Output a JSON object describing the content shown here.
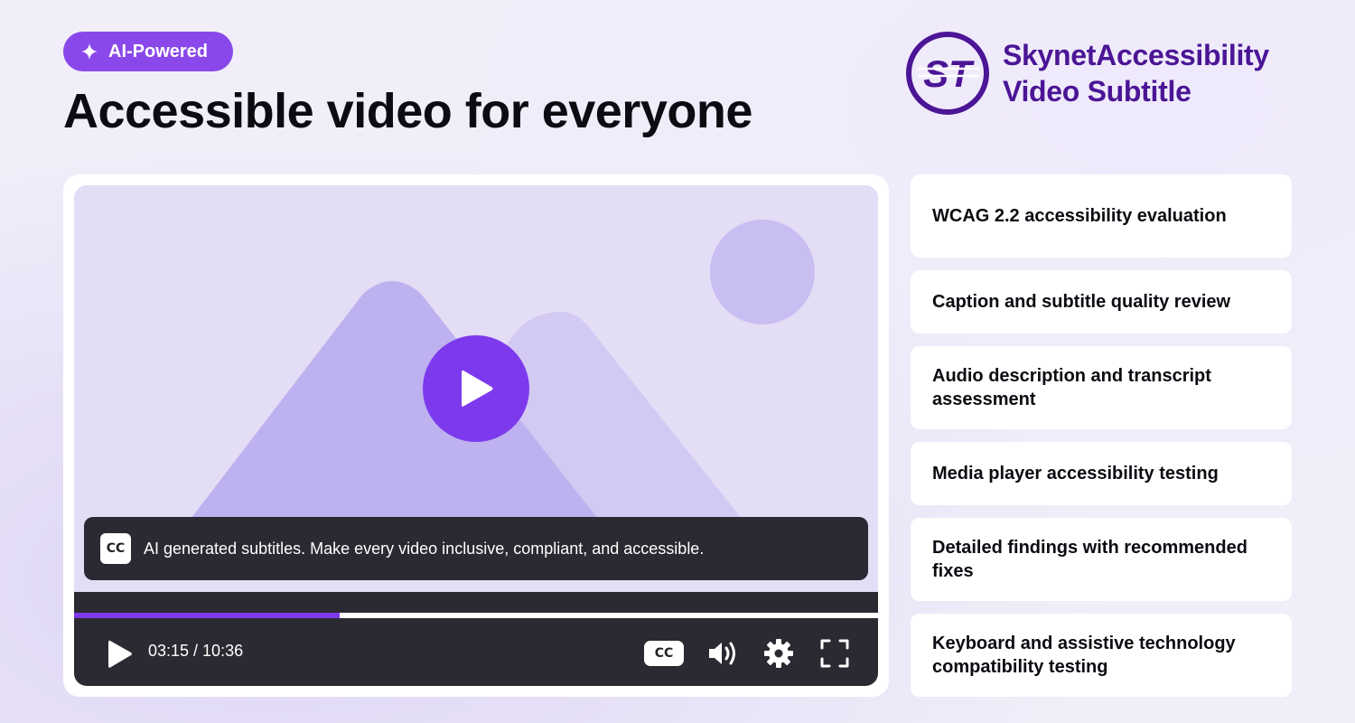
{
  "badge": {
    "label": "AI-Powered",
    "icon": "sparkle-icon"
  },
  "headline": "Accessible video for everyone",
  "brand": {
    "line1": "SkynetAccessibility",
    "line2": "Video Subtitle",
    "logo_text": "ST",
    "color": "#4b1596"
  },
  "player": {
    "subtitle_icon": "CC",
    "subtitle_text": "AI generated subtitles. Make every video inclusive, compliant, and accessible.",
    "current_time": "03:15",
    "duration": "10:36",
    "time_label": "03:15 / 10:36",
    "progress_fraction": 0.33,
    "cc_button_label": "CC",
    "accent_color": "#7d3aed"
  },
  "features": [
    "WCAG 2.2 accessibility evaluation",
    "Caption and subtitle quality review",
    "Audio description and transcript assessment",
    "Media player accessibility testing",
    "Detailed findings with recommended fixes",
    "Keyboard and assistive technology compatibility testing"
  ]
}
